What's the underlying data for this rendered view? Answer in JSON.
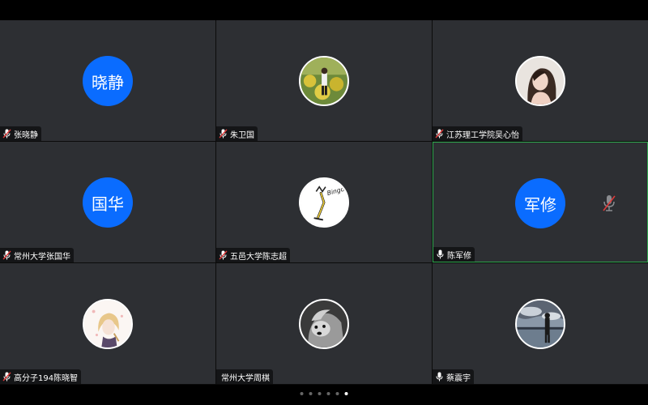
{
  "participants": [
    {
      "name": "张晓静",
      "avatar_text": "晓静",
      "avatar_type": "text",
      "mic": "muted"
    },
    {
      "name": "朱卫国",
      "avatar_type": "photo",
      "avatar_icon": "field-photo",
      "mic": "muted"
    },
    {
      "name": "江苏理工学院吴心怡",
      "avatar_type": "photo",
      "avatar_icon": "portrait-photo",
      "mic": "muted"
    },
    {
      "name": "常州大学张国华",
      "avatar_text": "国华",
      "avatar_type": "text",
      "mic": "muted"
    },
    {
      "name": "五邑大学陈志超",
      "avatar_type": "photo",
      "avatar_icon": "bingo-doodle",
      "mic": "muted"
    },
    {
      "name": "陈军修",
      "avatar_text": "军修",
      "avatar_type": "text",
      "mic": "on",
      "active": true
    },
    {
      "name": "高分子194陈晓智",
      "avatar_type": "photo",
      "avatar_icon": "anime-girl",
      "mic": "muted"
    },
    {
      "name": "常州大学周棋",
      "avatar_type": "photo",
      "avatar_icon": "dog-photo",
      "mic": "none"
    },
    {
      "name": "蔡震宇",
      "avatar_type": "photo",
      "avatar_icon": "lake-photo",
      "mic": "on"
    }
  ],
  "pager": {
    "count": 6,
    "current": 6
  },
  "colors": {
    "tile_bg": "#2d2f33",
    "avatar_blue": "#0a6cff",
    "active_border": "#2fa84f",
    "muted_red": "#e03a3a"
  }
}
